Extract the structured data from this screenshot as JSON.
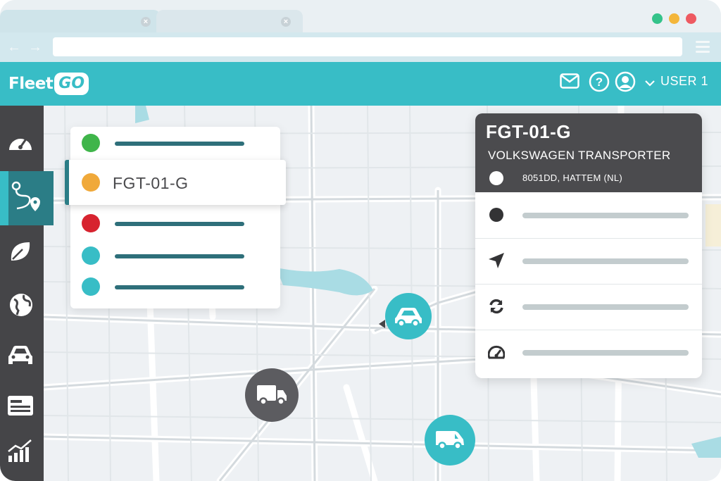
{
  "browser": {
    "tabs": [
      {
        "close_icon": "×"
      },
      {
        "close_icon": "×"
      }
    ],
    "window_controls": {
      "colors": [
        "#34c38a",
        "#f4b63a",
        "#ee5a61"
      ]
    },
    "nav": {
      "back_icon": "←",
      "forward_icon": "→"
    }
  },
  "header": {
    "logo_fleet": "Fleet",
    "logo_go": "GO",
    "user_label": "USER 1",
    "icons": [
      "mail-icon",
      "help-icon",
      "user-icon",
      "chevron-down-icon"
    ]
  },
  "sidebar": {
    "items": [
      {
        "icon": "speedometer-icon"
      },
      {
        "icon": "route-icon",
        "active": true
      },
      {
        "icon": "leaf-icon"
      },
      {
        "icon": "globe-icon"
      },
      {
        "icon": "car-icon"
      },
      {
        "icon": "card-icon"
      },
      {
        "icon": "chart-icon"
      }
    ]
  },
  "vehicle_list": {
    "items": [
      {
        "status_color": "#3fb54a",
        "label": ""
      },
      {
        "status_color": "#f0a93a",
        "label": "FGT-01-G",
        "selected": true
      },
      {
        "status_color": "#d7232f",
        "label": ""
      },
      {
        "status_color": "#38bdc6",
        "label": ""
      },
      {
        "status_color": "#38bdc6",
        "label": ""
      }
    ]
  },
  "detail": {
    "plate": "FGT-01-G",
    "model": "VOLKSWAGEN TRANSPORTER",
    "address": "8051DD, HATTEM (NL)",
    "rows": [
      {
        "icon": "dot-icon"
      },
      {
        "icon": "navigation-arrow-icon"
      },
      {
        "icon": "refresh-icon"
      },
      {
        "icon": "gauge-icon"
      }
    ]
  },
  "markers": [
    {
      "icon": "car-icon",
      "color": "#38bdc6"
    },
    {
      "icon": "truck-icon",
      "color": "#5c5c60"
    },
    {
      "icon": "van-icon",
      "color": "#38bdc6"
    }
  ],
  "colors": {
    "accent": "#38bdc6",
    "dark": "#454548",
    "teal_dark": "#2b7d86"
  }
}
